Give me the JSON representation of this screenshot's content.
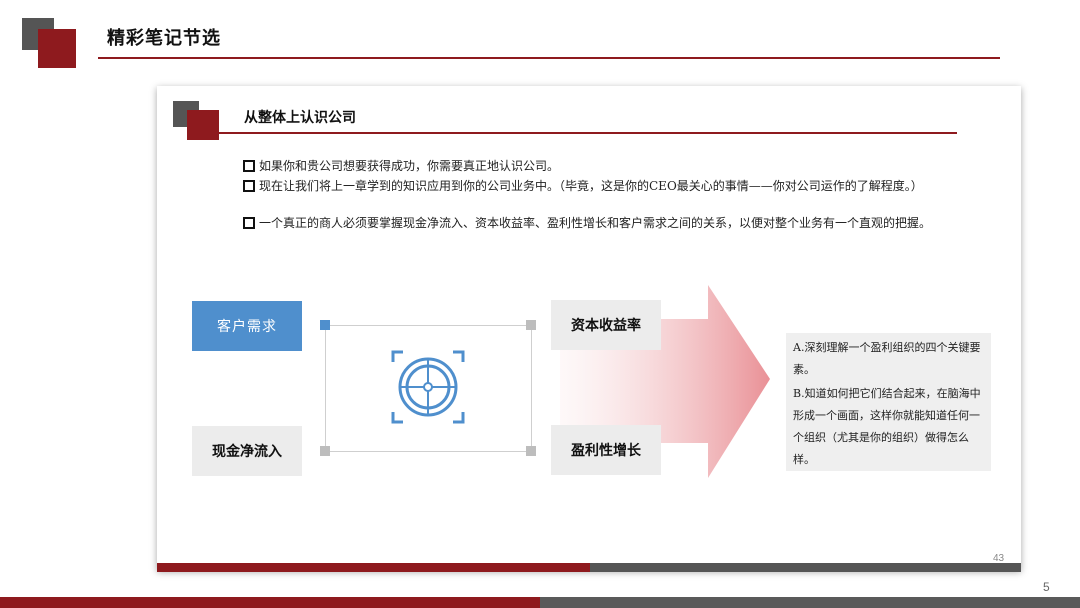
{
  "slide": {
    "heading": "精彩笔记节选",
    "page_number": "5"
  },
  "card": {
    "title": "从整体上认识公司",
    "page_number": "43",
    "bullets": [
      "如果你和贵公司想要获得成功，你需要真正地认识公司。",
      "现在让我们将上一章学到的知识应用到你的公司业务中。（毕竟，这是你的CEO最关心的事情——你对公司运作的了解程度。）",
      "一个真正的商人必须要掌握现金净流入、资本收益率、盈利性增长和客户需求之间的关系，以便对整个业务有一个直观的把握。"
    ],
    "diagram": {
      "customer_demand": "客户需求",
      "cash_inflow": "现金净流入",
      "return_on_capital": "资本收益率",
      "profitable_growth": "盈利性增长",
      "center_icon": "target-icon"
    },
    "notes": [
      "A.深刻理解一个盈利组织的四个关键要素。",
      "B.知道如何把它们结合起来，在脑海中形成一个画面，这样你就能知道任何一个组织（尤其是你的组织）做得怎么样。"
    ]
  },
  "colors": {
    "brand_red": "#8e1a1e",
    "dark_grey": "#555555",
    "accent_blue": "#4f8fcd",
    "light_grey": "#ececec"
  }
}
